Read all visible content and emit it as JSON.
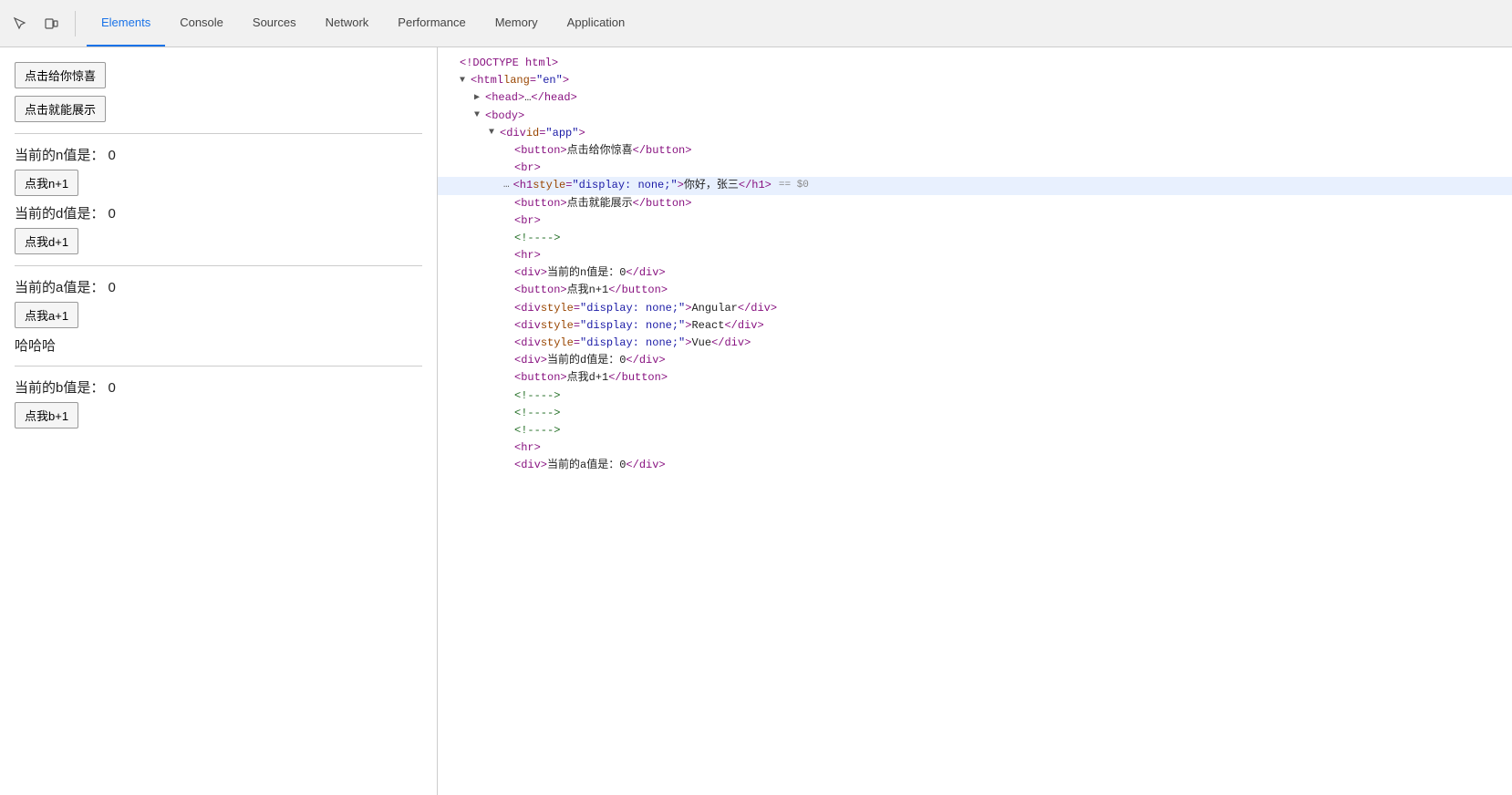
{
  "devtools": {
    "tabs": [
      {
        "label": "Elements",
        "active": true
      },
      {
        "label": "Console",
        "active": false
      },
      {
        "label": "Sources",
        "active": false
      },
      {
        "label": "Network",
        "active": false
      },
      {
        "label": "Performance",
        "active": false
      },
      {
        "label": "Memory",
        "active": false
      },
      {
        "label": "Application",
        "active": false
      }
    ]
  },
  "app": {
    "btn1": "点击给你惊喜",
    "btn2": "点击就能展示",
    "n_label": "当前的n值是：",
    "n_value": "0",
    "btn_n": "点我n+1",
    "d_label": "当前的d值是：",
    "d_value": "0",
    "btn_d": "点我d+1",
    "a_label": "当前的a值是：",
    "a_value": "0",
    "btn_a": "点我a+1",
    "haha": "哈哈哈",
    "b_label": "当前的b值是：",
    "b_value": "0",
    "btn_b": "点我b+1"
  },
  "elements": {
    "lines": [
      {
        "indent": 1,
        "content": "<!DOCTYPE html>",
        "type": "doctype"
      },
      {
        "indent": 1,
        "content": "<html lang=\"en\">",
        "type": "tag"
      },
      {
        "indent": 2,
        "triangle": "▶",
        "content": "<head>…</head>",
        "type": "tag"
      },
      {
        "indent": 2,
        "triangle": "▼",
        "content": "<body>",
        "type": "tag"
      },
      {
        "indent": 3,
        "triangle": "▼",
        "content": "<div id=\"app\">",
        "type": "tag"
      },
      {
        "indent": 4,
        "content": "<button>点击给你惊喜</button>",
        "type": "tag"
      },
      {
        "indent": 4,
        "content": "<br>",
        "type": "tag"
      },
      {
        "indent": 4,
        "dots": true,
        "content": "<h1 style=\"display: none;\">你好，张三</h1>",
        "type": "tag",
        "highlight": true,
        "dollar_zero": true
      },
      {
        "indent": 4,
        "content": "<button>点击就能展示</button>",
        "type": "tag"
      },
      {
        "indent": 4,
        "content": "<br>",
        "type": "tag"
      },
      {
        "indent": 4,
        "content": "<!---->",
        "type": "comment"
      },
      {
        "indent": 4,
        "content": "<hr>",
        "type": "tag"
      },
      {
        "indent": 4,
        "content": "<div>当前的n值是：0</div>",
        "type": "tag"
      },
      {
        "indent": 4,
        "content": "<button>点我n+1</button>",
        "type": "tag"
      },
      {
        "indent": 4,
        "content": "<div style=\"display: none;\">Angular</div>",
        "type": "tag"
      },
      {
        "indent": 4,
        "content": "<div style=\"display: none;\">React</div>",
        "type": "tag"
      },
      {
        "indent": 4,
        "content": "<div style=\"display: none;\">Vue</div>",
        "type": "tag"
      },
      {
        "indent": 4,
        "content": "<div>当前的d值是：0</div>",
        "type": "tag"
      },
      {
        "indent": 4,
        "content": "<button>点我d+1</button>",
        "type": "tag"
      },
      {
        "indent": 4,
        "content": "<!---->",
        "type": "comment"
      },
      {
        "indent": 4,
        "content": "<!---->",
        "type": "comment"
      },
      {
        "indent": 4,
        "content": "<!---->",
        "type": "comment"
      },
      {
        "indent": 4,
        "content": "<hr>",
        "type": "tag"
      },
      {
        "indent": 4,
        "content": "<div>当前的a值是：0</div>",
        "type": "tag"
      }
    ]
  }
}
